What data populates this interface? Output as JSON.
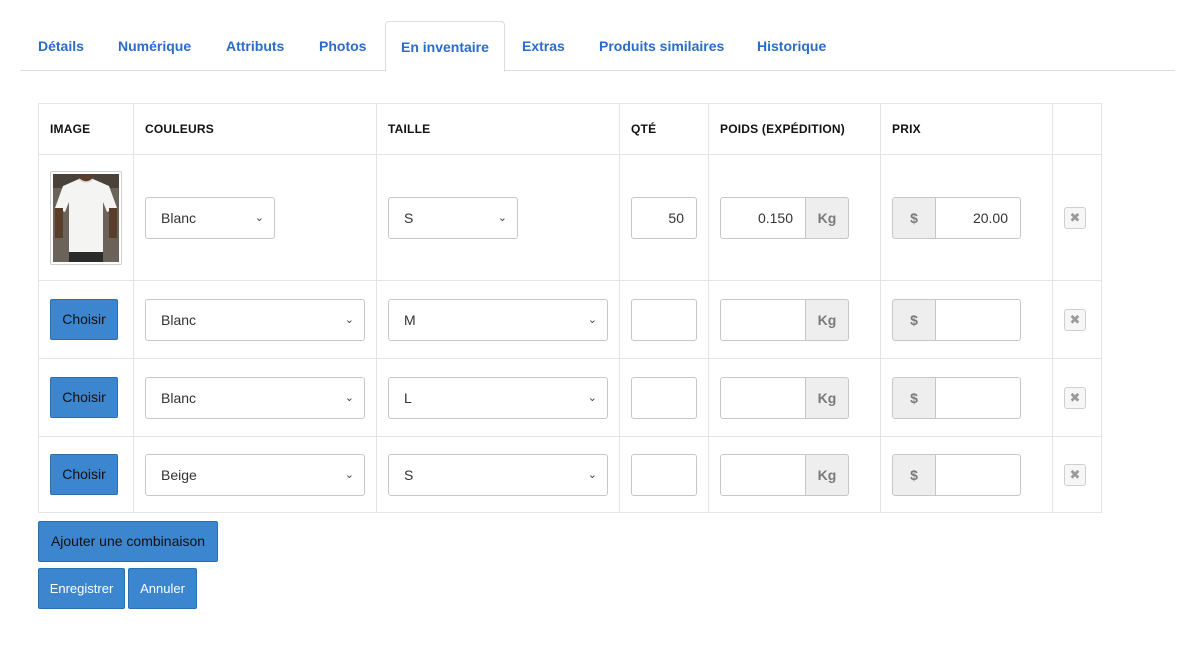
{
  "tabs": [
    {
      "label": "Détails"
    },
    {
      "label": "Numérique"
    },
    {
      "label": "Attributs"
    },
    {
      "label": "Photos"
    },
    {
      "label": "En inventaire",
      "active": true
    },
    {
      "label": "Extras"
    },
    {
      "label": "Produits similaires"
    },
    {
      "label": "Historique"
    }
  ],
  "table": {
    "headers": {
      "image": "IMAGE",
      "color": "COULEURS",
      "size": "TAILLE",
      "qty": "QTÉ",
      "weight": "POIDS (EXPÉDITION)",
      "price": "PRIX"
    },
    "weight_unit": "Kg",
    "currency": "$",
    "choose_label": "Choisir",
    "rows": [
      {
        "has_image": true,
        "image_icon": "white-tshirt-photo",
        "color": "Blanc",
        "size": "S",
        "qty": "50",
        "weight": "0.150",
        "price": "20.00"
      },
      {
        "has_image": false,
        "color": "Blanc",
        "size": "M",
        "qty": "",
        "weight": "",
        "price": ""
      },
      {
        "has_image": false,
        "color": "Blanc",
        "size": "L",
        "qty": "",
        "weight": "",
        "price": ""
      },
      {
        "has_image": false,
        "color": "Beige",
        "size": "S",
        "qty": "",
        "weight": "",
        "price": ""
      }
    ]
  },
  "actions": {
    "add_combination": "Ajouter une combinaison",
    "save": "Enregistrer",
    "cancel": "Annuler"
  },
  "colors": {
    "accent": "#3b86cf",
    "tab_text": "#2a6cc8"
  },
  "icons": {
    "chevron": "chevron-down-icon",
    "delete": "close-icon"
  }
}
